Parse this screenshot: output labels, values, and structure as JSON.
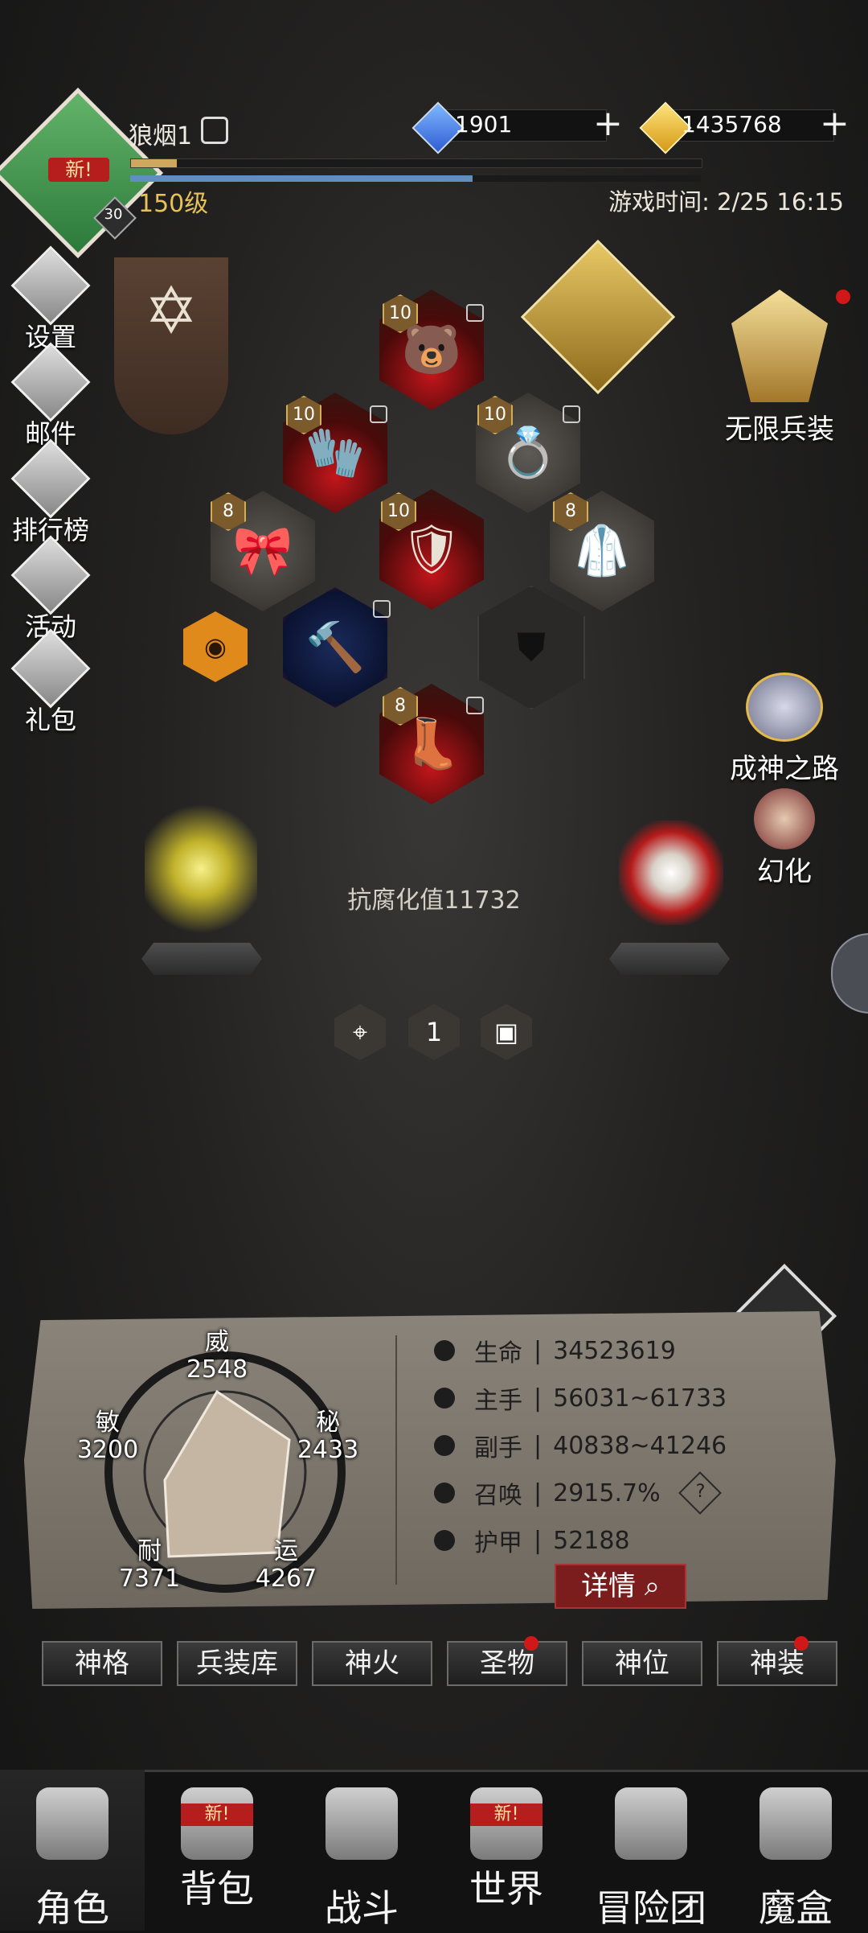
{
  "header": {
    "new_tag": "新!",
    "avatar_level": "30",
    "player_name": "狼烟1",
    "level": "150级",
    "game_time": "游戏时间: 2/25 16:15",
    "xp_progress": 0.08,
    "hp_progress": 0.6,
    "gems": "1901",
    "gold": "1435768"
  },
  "left_menu": [
    {
      "label": "设置",
      "icon": "gear-icon"
    },
    {
      "label": "邮件",
      "icon": "mail-icon"
    },
    {
      "label": "排行榜",
      "icon": "ranking-icon"
    },
    {
      "label": "活动",
      "icon": "event-icon"
    },
    {
      "label": "礼包",
      "icon": "gift-icon"
    }
  ],
  "equipment": [
    {
      "slot": "helmet",
      "level": "10"
    },
    {
      "slot": "gloves",
      "level": "10"
    },
    {
      "slot": "ring",
      "level": "10"
    },
    {
      "slot": "belt",
      "level": "8"
    },
    {
      "slot": "armor",
      "level": "10"
    },
    {
      "slot": "cloak",
      "level": "8"
    },
    {
      "slot": "weapon",
      "level": ""
    },
    {
      "slot": "boots",
      "level": "8"
    }
  ],
  "right_menu": {
    "infinite_gear": "无限兵装",
    "path_to_god": "成神之路",
    "transform": "幻化"
  },
  "anti_corruption": "抗腐化值11732",
  "page_number": "1",
  "radar": {
    "wei": {
      "label": "威",
      "value": "2548"
    },
    "mi": {
      "label": "秘",
      "value": "2433"
    },
    "yun": {
      "label": "运",
      "value": "4267"
    },
    "nai": {
      "label": "耐",
      "value": "7371"
    },
    "min": {
      "label": "敏",
      "value": "3200"
    }
  },
  "stats": [
    {
      "label": "生命",
      "value": "34523619"
    },
    {
      "label": "主手",
      "value": "56031~61733"
    },
    {
      "label": "副手",
      "value": "40838~41246"
    },
    {
      "label": "召唤",
      "value": "2915.7%"
    },
    {
      "label": "护甲",
      "value": "52188"
    }
  ],
  "stat_sep": "|",
  "help_mark": "?",
  "detail_button": "详情",
  "tabs": [
    "神格",
    "兵装库",
    "神火",
    "圣物",
    "神位",
    "神装"
  ],
  "bottom_nav": [
    "角色",
    "背包",
    "战斗",
    "世界",
    "冒险团",
    "魔盒"
  ],
  "colors": {
    "accent_gold": "#e6c258",
    "badge_red": "#d01818"
  }
}
